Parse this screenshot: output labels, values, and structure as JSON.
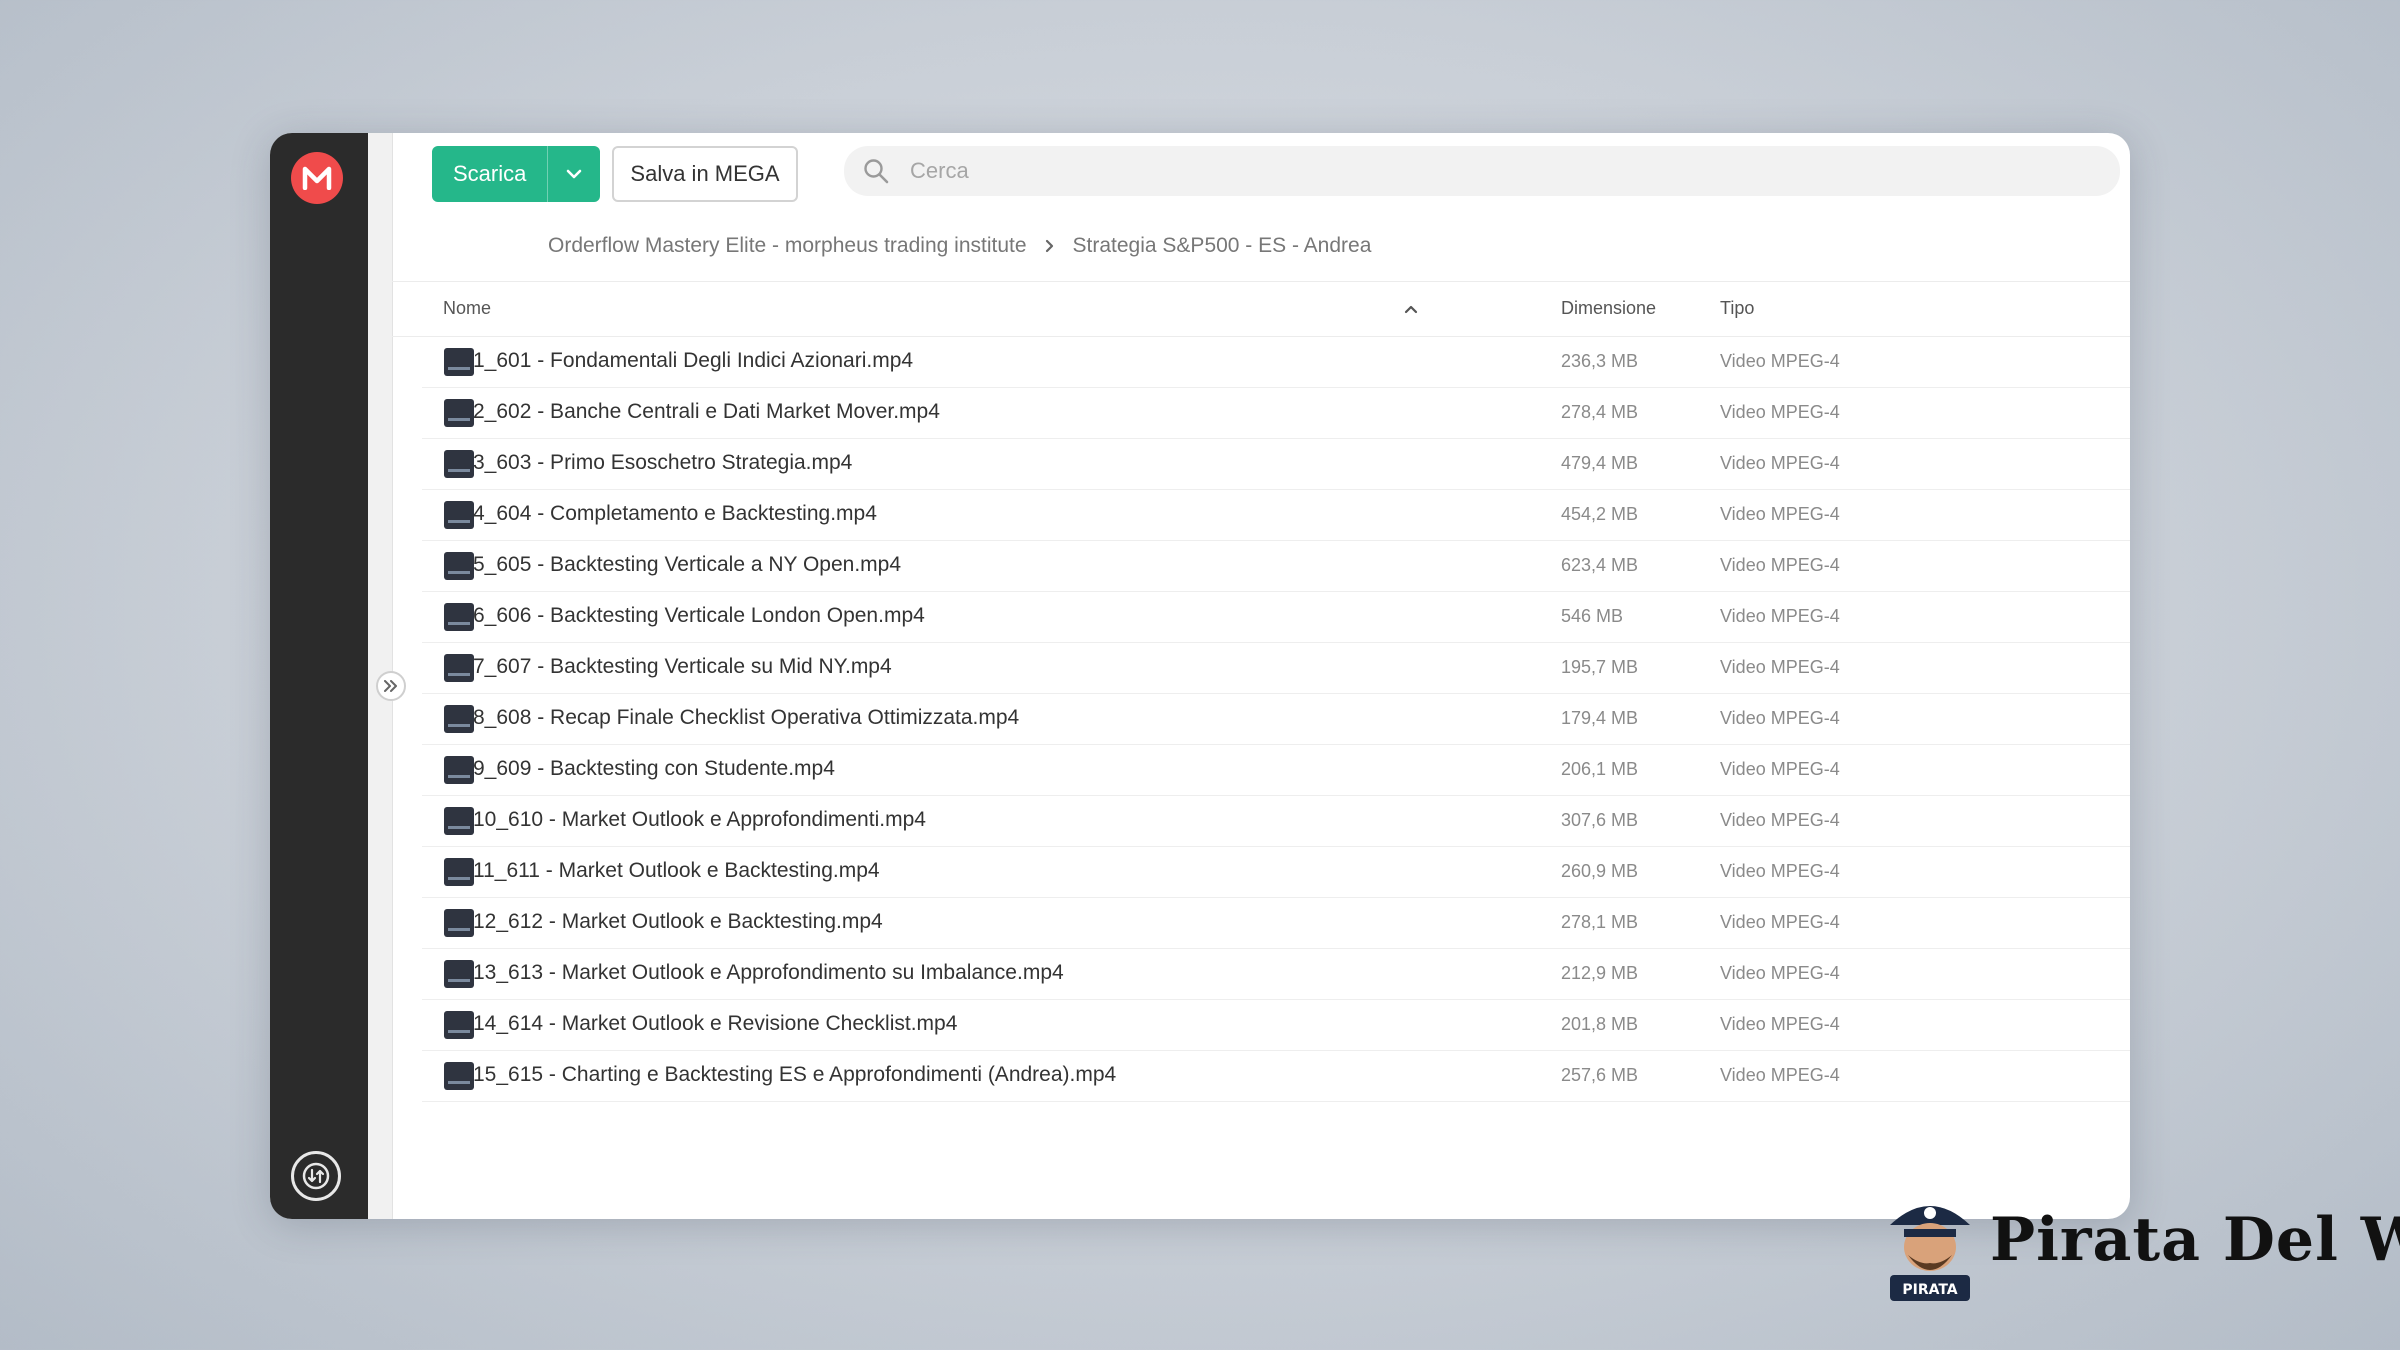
{
  "toolbar": {
    "download_label": "Scarica",
    "save_label": "Salva in MEGA",
    "search_placeholder": "Cerca"
  },
  "breadcrumb": {
    "items": [
      "Orderflow Mastery Elite - morpheus trading institute",
      "Strategia S&P500 - ES - Andrea"
    ]
  },
  "columns": {
    "name": "Nome",
    "size": "Dimensione",
    "type": "Tipo"
  },
  "files": [
    {
      "name": "1_601 - Fondamentali Degli Indici Azionari.mp4",
      "size": "236,3 MB",
      "type": "Video MPEG-4"
    },
    {
      "name": "2_602 - Banche Centrali e Dati Market Mover.mp4",
      "size": "278,4 MB",
      "type": "Video MPEG-4"
    },
    {
      "name": "3_603 - Primo Esoschetro Strategia.mp4",
      "size": "479,4 MB",
      "type": "Video MPEG-4"
    },
    {
      "name": "4_604 - Completamento e Backtesting.mp4",
      "size": "454,2 MB",
      "type": "Video MPEG-4"
    },
    {
      "name": "5_605 - Backtesting Verticale a NY Open.mp4",
      "size": "623,4 MB",
      "type": "Video MPEG-4"
    },
    {
      "name": "6_606 - Backtesting Verticale London Open.mp4",
      "size": "546 MB",
      "type": "Video MPEG-4"
    },
    {
      "name": "7_607 - Backtesting Verticale su Mid NY.mp4",
      "size": "195,7 MB",
      "type": "Video MPEG-4"
    },
    {
      "name": "8_608 - Recap Finale Checklist Operativa Ottimizzata.mp4",
      "size": "179,4 MB",
      "type": "Video MPEG-4"
    },
    {
      "name": "9_609 - Backtesting con Studente.mp4",
      "size": "206,1 MB",
      "type": "Video MPEG-4"
    },
    {
      "name": "10_610 - Market Outlook e Approfondimenti.mp4",
      "size": "307,6 MB",
      "type": "Video MPEG-4"
    },
    {
      "name": "11_611 - Market Outlook e Backtesting.mp4",
      "size": "260,9 MB",
      "type": "Video MPEG-4"
    },
    {
      "name": "12_612 - Market Outlook e Backtesting.mp4",
      "size": "278,1 MB",
      "type": "Video MPEG-4"
    },
    {
      "name": "13_613 - Market Outlook e Approfondimento su Imbalance.mp4",
      "size": "212,9 MB",
      "type": "Video MPEG-4"
    },
    {
      "name": "14_614 - Market Outlook e Revisione Checklist.mp4",
      "size": "201,8 MB",
      "type": "Video MPEG-4"
    },
    {
      "name": "15_615 - Charting e Backtesting ES e Approfondimenti (Andrea).mp4",
      "size": "257,6 MB",
      "type": "Video MPEG-4"
    }
  ],
  "brand": {
    "text": "Pirata Del Web",
    "badge": "PIRATA"
  },
  "colors": {
    "accent": "#25b78a",
    "mega_red": "#f04b4b",
    "rail": "#2b2b2b"
  },
  "icons": {
    "logo": "mega-logo-icon",
    "caret": "chevron-down-icon",
    "search": "search-icon",
    "breadcrumb_sep": "chevron-right-icon",
    "sort": "sort-ascending-icon",
    "expand": "double-chevron-right-icon",
    "transfer": "transfer-manager-icon",
    "file": "video-thumbnail-icon"
  }
}
